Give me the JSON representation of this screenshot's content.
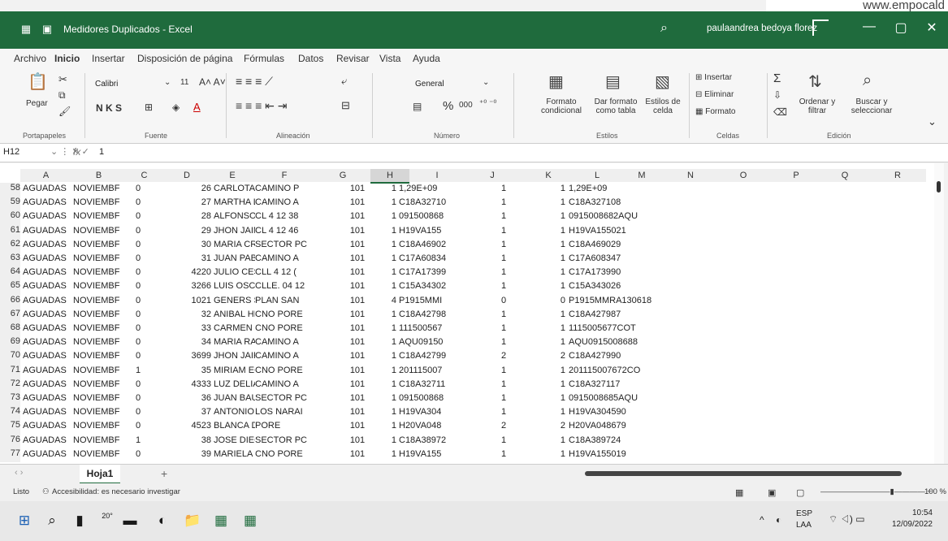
{
  "watermark": "www.empocald",
  "titlebar": {
    "title": "Medidores Duplicados - Excel",
    "user": "paulaandrea bedoya florez"
  },
  "menu": [
    "Archivo",
    "Inicio",
    "Insertar",
    "Disposición de página",
    "Fórmulas",
    "Datos",
    "Revisar",
    "Vista",
    "Ayuda"
  ],
  "ribbon": {
    "paste": "Pegar",
    "font_name": "Calibri",
    "font_size": "11",
    "font_format": "N  K  S",
    "number_format": "General",
    "percent": "%",
    "thousands": "000",
    "cond_format": "Formato condicional",
    "table_format": "Dar formato como tabla",
    "cell_styles": "Estilos de celda",
    "insert": "Insertar",
    "delete": "Eliminar",
    "format": "Formato",
    "sort": "Ordenar y filtrar",
    "find": "Buscar y seleccionar",
    "groups": [
      "Portapapeles",
      "Fuente",
      "Alineación",
      "Número",
      "Estilos",
      "Celdas",
      "Edición"
    ]
  },
  "formula_bar": {
    "name_box": "H12",
    "fx": "fx",
    "value": "1"
  },
  "columns": [
    "A",
    "B",
    "C",
    "D",
    "E",
    "F",
    "G",
    "H",
    "I",
    "J",
    "K",
    "L",
    "M",
    "N",
    "O",
    "P",
    "Q",
    "R"
  ],
  "rows": [
    {
      "n": "58",
      "a": "AGUADAS",
      "b": "NOVIEMBF",
      "c": "0",
      "d": "26",
      "e": "CARLOTA /",
      "f": "CAMINO P",
      "g": "101",
      "h": "1",
      "i": "1,29E+09",
      "j": "1",
      "k": "1",
      "l": "1,29E+09"
    },
    {
      "n": "59",
      "a": "AGUADAS",
      "b": "NOVIEMBF",
      "c": "0",
      "d": "27",
      "e": "MARTHA L",
      "f": "CAMINO A",
      "g": "101",
      "h": "1",
      "i": "C18A32710",
      "j": "1",
      "k": "1",
      "l": "C18A327108"
    },
    {
      "n": "60",
      "a": "AGUADAS",
      "b": "NOVIEMBF",
      "c": "0",
      "d": "28",
      "e": "ALFONSO (",
      "f": "CL 4 12 38",
      "g": "101",
      "h": "1",
      "i": "091500868",
      "j": "1",
      "k": "1",
      "l": "0915008682AQU"
    },
    {
      "n": "61",
      "a": "AGUADAS",
      "b": "NOVIEMBF",
      "c": "0",
      "d": "29",
      "e": "JHON JAIM",
      "f": "CL 4 12 46",
      "g": "101",
      "h": "1",
      "i": "H19VA155",
      "j": "1",
      "k": "1",
      "l": "H19VA155021"
    },
    {
      "n": "62",
      "a": "AGUADAS",
      "b": "NOVIEMBF",
      "c": "0",
      "d": "30",
      "e": "MARIA CRI",
      "f": "SECTOR PC",
      "g": "101",
      "h": "1",
      "i": "C18A46902",
      "j": "1",
      "k": "1",
      "l": "C18A469029"
    },
    {
      "n": "63",
      "a": "AGUADAS",
      "b": "NOVIEMBF",
      "c": "0",
      "d": "31",
      "e": "JUAN PABL",
      "f": "CAMINO A",
      "g": "101",
      "h": "1",
      "i": "C17A60834",
      "j": "1",
      "k": "1",
      "l": "C17A608347"
    },
    {
      "n": "64",
      "a": "AGUADAS",
      "b": "NOVIEMBF",
      "c": "0",
      "d": "4220",
      "e": "JULIO CESA",
      "f": "CLL 4 12 (",
      "g": "101",
      "h": "1",
      "i": "C17A17399",
      "j": "1",
      "k": "1",
      "l": "C17A173990"
    },
    {
      "n": "65",
      "a": "AGUADAS",
      "b": "NOVIEMBF",
      "c": "0",
      "d": "3266",
      "e": "LUIS OSCAI",
      "f": "CLLE. 04 12",
      "g": "101",
      "h": "1",
      "i": "C15A34302",
      "j": "1",
      "k": "1",
      "l": "C15A343026"
    },
    {
      "n": "66",
      "a": "AGUADAS",
      "b": "NOVIEMBF",
      "c": "0",
      "d": "1021",
      "e": "GENERS S",
      "f": "PLAN SAN",
      "g": "101",
      "h": "4",
      "i": "P1915MMI",
      "j": "0",
      "k": "0",
      "l": "P1915MMRA130618"
    },
    {
      "n": "67",
      "a": "AGUADAS",
      "b": "NOVIEMBF",
      "c": "0",
      "d": "32",
      "e": "ANIBAL HE",
      "f": "CNO PORE",
      "g": "101",
      "h": "1",
      "i": "C18A42798",
      "j": "1",
      "k": "1",
      "l": "C18A427987"
    },
    {
      "n": "68",
      "a": "AGUADAS",
      "b": "NOVIEMBF",
      "c": "0",
      "d": "33",
      "e": "CARMEN E",
      "f": "CNO PORE",
      "g": "101",
      "h": "1",
      "i": "111500567",
      "j": "1",
      "k": "1",
      "l": "1115005677COT"
    },
    {
      "n": "69",
      "a": "AGUADAS",
      "b": "NOVIEMBF",
      "c": "0",
      "d": "34",
      "e": "MARIA RAI",
      "f": "CAMINO A",
      "g": "101",
      "h": "1",
      "i": "AQU09150",
      "j": "1",
      "k": "1",
      "l": "AQU0915008688"
    },
    {
      "n": "70",
      "a": "AGUADAS",
      "b": "NOVIEMBF",
      "c": "0",
      "d": "3699",
      "e": "JHON JAIR",
      "f": "CAMINO A",
      "g": "101",
      "h": "1",
      "i": "C18A42799",
      "j": "2",
      "k": "2",
      "l": "C18A427990"
    },
    {
      "n": "71",
      "a": "AGUADAS",
      "b": "NOVIEMBF",
      "c": "1",
      "d": "35",
      "e": "MIRIAM EC",
      "f": "CNO PORE",
      "g": "101",
      "h": "1",
      "i": "201115007",
      "j": "1",
      "k": "1",
      "l": "201115007672CO"
    },
    {
      "n": "72",
      "a": "AGUADAS",
      "b": "NOVIEMBF",
      "c": "0",
      "d": "4333",
      "e": "LUZ DELIA",
      "f": "CAMINO A",
      "g": "101",
      "h": "1",
      "i": "C18A32711",
      "j": "1",
      "k": "1",
      "l": "C18A327117"
    },
    {
      "n": "73",
      "a": "AGUADAS",
      "b": "NOVIEMBF",
      "c": "0",
      "d": "36",
      "e": "JUAN BAU",
      "f": "SECTOR PC",
      "g": "101",
      "h": "1",
      "i": "091500868",
      "j": "1",
      "k": "1",
      "l": "0915008685AQU"
    },
    {
      "n": "74",
      "a": "AGUADAS",
      "b": "NOVIEMBF",
      "c": "0",
      "d": "37",
      "e": "ANTONIO I",
      "f": "LOS NARAI",
      "g": "101",
      "h": "1",
      "i": "H19VA304",
      "j": "1",
      "k": "1",
      "l": "H19VA304590"
    },
    {
      "n": "75",
      "a": "AGUADAS",
      "b": "NOVIEMBF",
      "c": "0",
      "d": "4523",
      "e": "BLANCA D",
      "f": "PORE",
      "g": "101",
      "h": "1",
      "i": "H20VA048",
      "j": "2",
      "k": "2",
      "l": "H20VA048679"
    },
    {
      "n": "76",
      "a": "AGUADAS",
      "b": "NOVIEMBF",
      "c": "1",
      "d": "38",
      "e": "JOSE DIEG",
      "f": "SECTOR PC",
      "g": "101",
      "h": "1",
      "i": "C18A38972",
      "j": "1",
      "k": "1",
      "l": "C18A389724"
    },
    {
      "n": "77",
      "a": "AGUADAS",
      "b": "NOVIEMBF",
      "c": "0",
      "d": "39",
      "e": "MARIELA N",
      "f": "CNO PORE",
      "g": "101",
      "h": "1",
      "i": "H19VA155",
      "j": "1",
      "k": "1",
      "l": "H19VA155019"
    }
  ],
  "sheet_tab": "Hoja1",
  "status": {
    "ready": "Listo",
    "accessibility": "Accesibilidad: es necesario investigar",
    "zoom": "100 %"
  },
  "taskbar": {
    "temp": "20°",
    "lang": "ESP",
    "lang2": "LAA",
    "time": "10:54",
    "date": "12/09/2022"
  }
}
